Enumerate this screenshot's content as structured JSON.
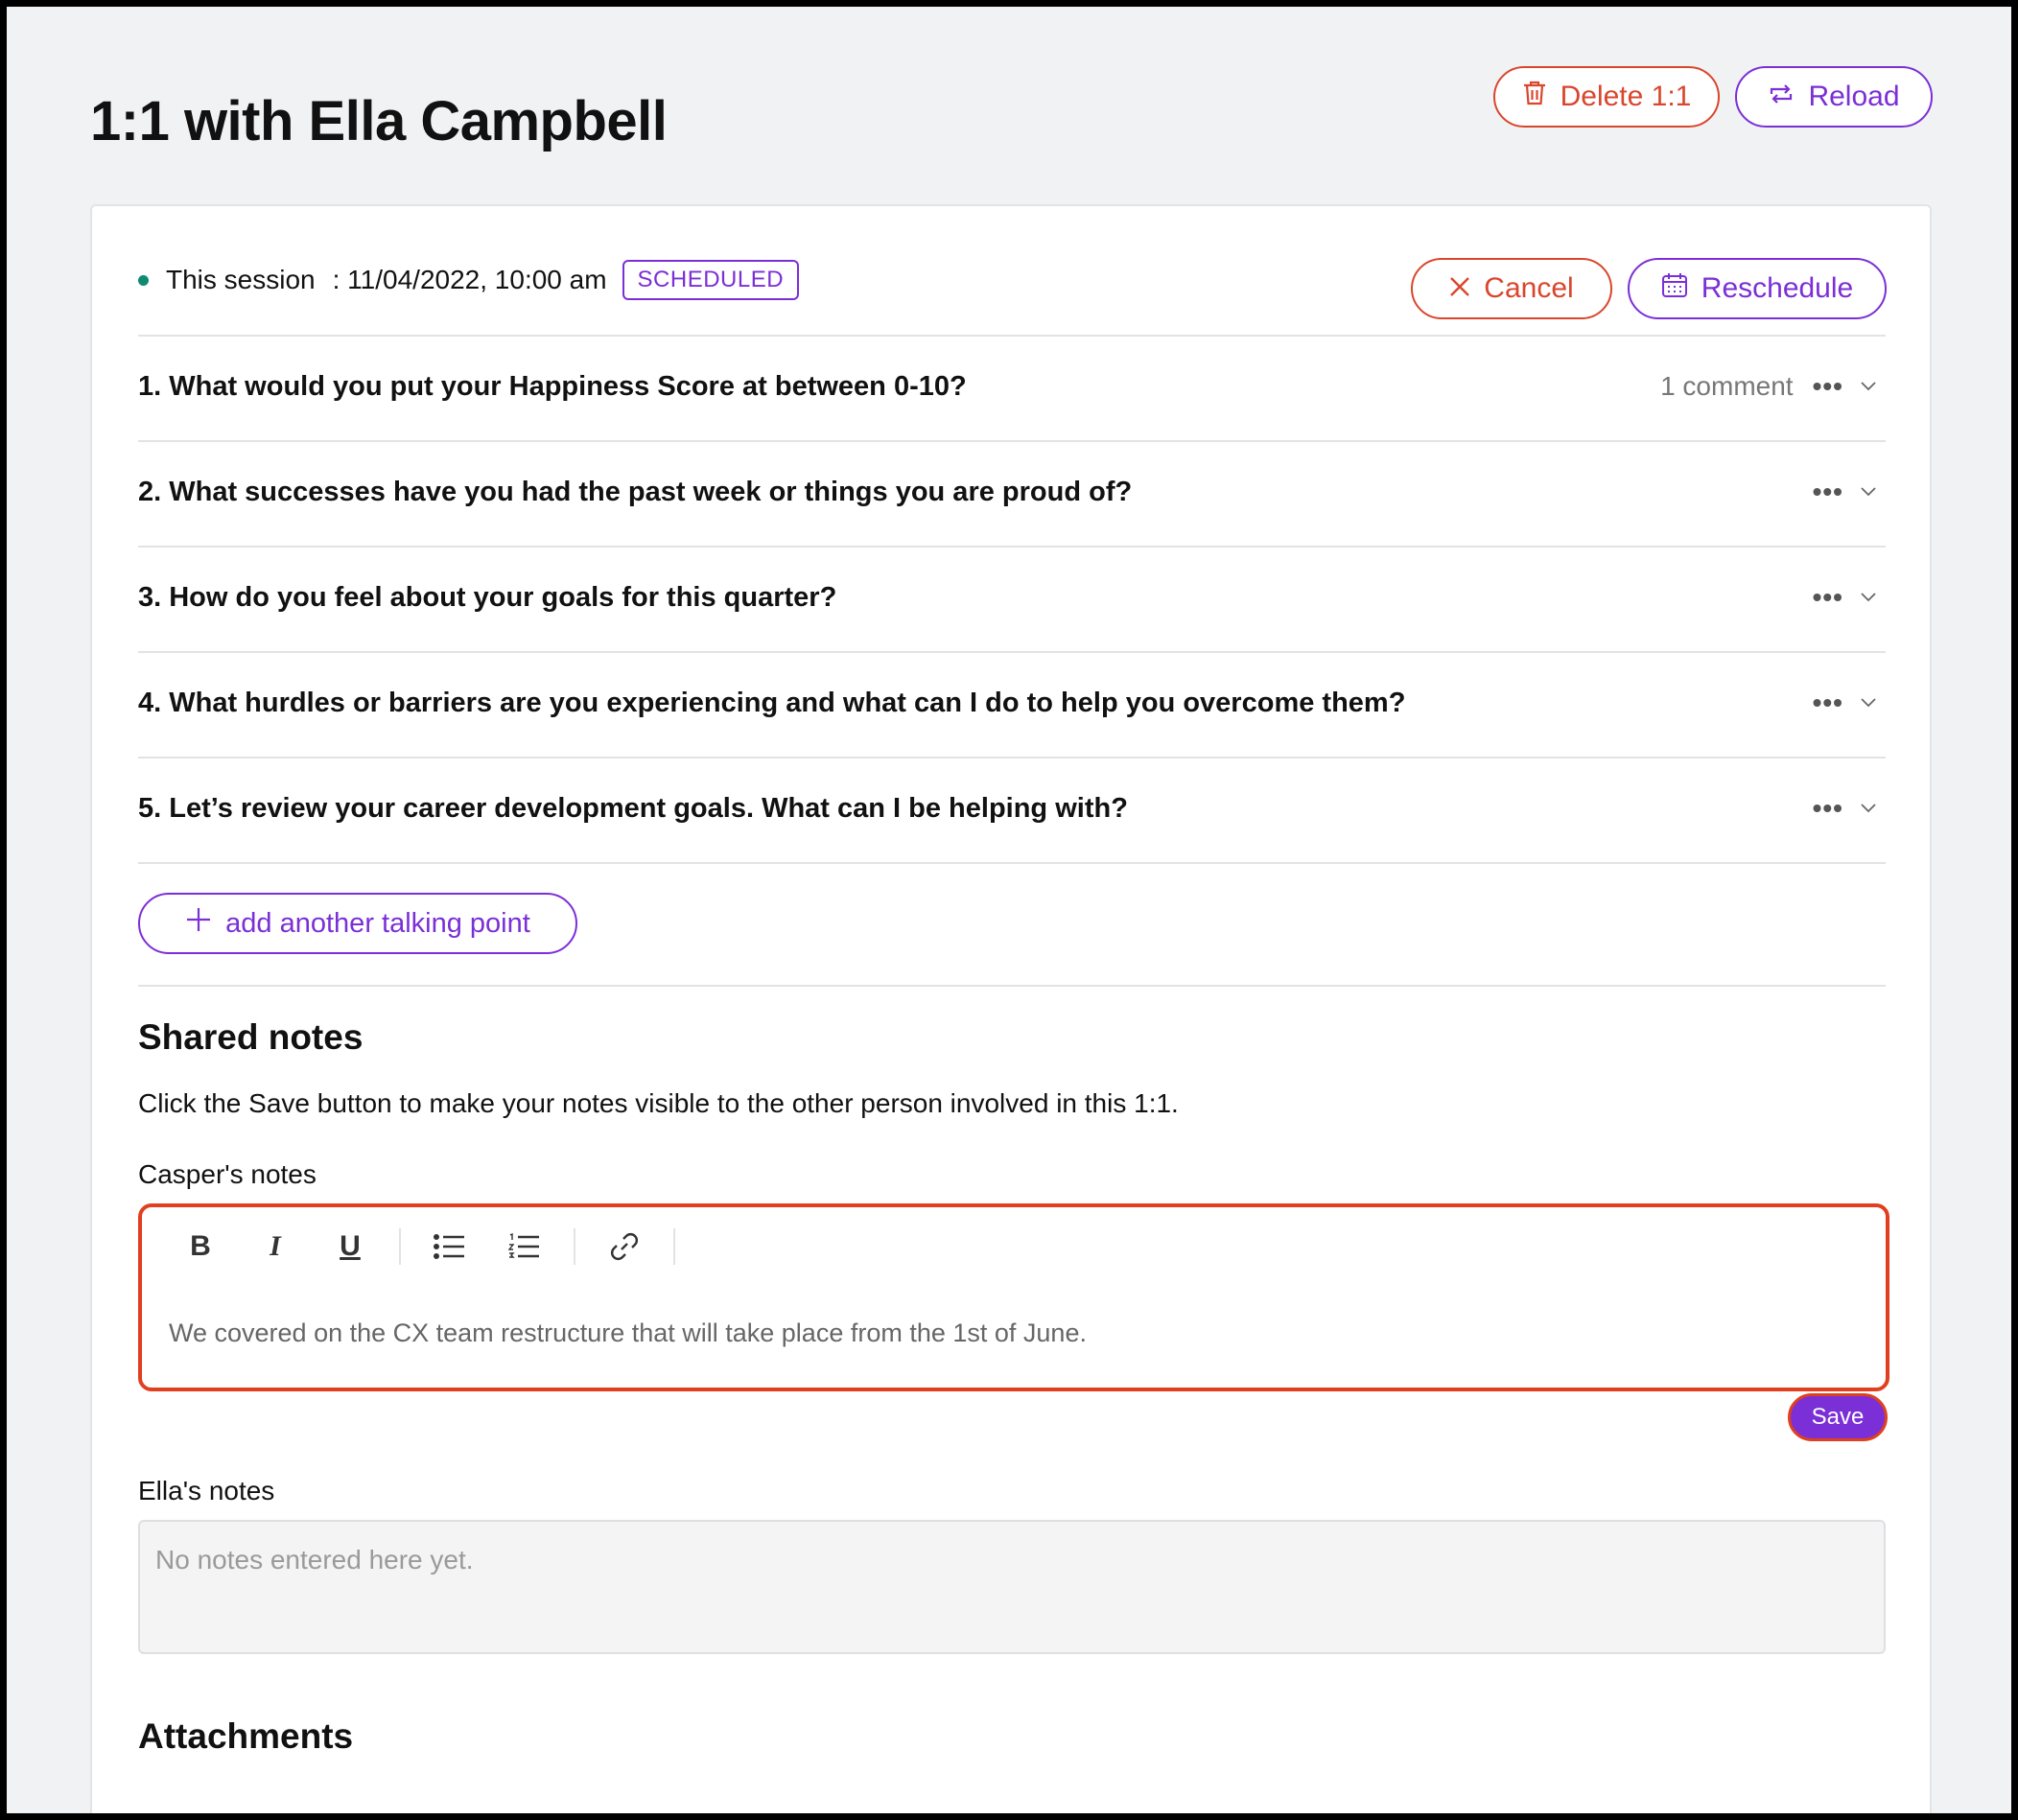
{
  "header": {
    "title": "1:1 with Ella Campbell",
    "delete_label": "Delete 1:1",
    "reload_label": "Reload"
  },
  "session": {
    "label": "This session",
    "datetime": ": 11/04/2022, 10:00 am",
    "status": "SCHEDULED",
    "cancel_label": "Cancel",
    "reschedule_label": "Reschedule"
  },
  "talking_points": [
    {
      "text": "1. What would you put your Happiness Score at between 0-10?",
      "comments": "1 comment"
    },
    {
      "text": "2. What successes have you had the past week or things you are proud of?",
      "comments": ""
    },
    {
      "text": "3. How do you feel about your goals for this quarter?",
      "comments": ""
    },
    {
      "text": "4. What hurdles or barriers are you experiencing and what can I do to help you overcome them?",
      "comments": ""
    },
    {
      "text": "5. Let’s review your career development goals. What can I be helping with?",
      "comments": ""
    }
  ],
  "add_talking_point_label": "add another talking point",
  "shared_notes": {
    "heading": "Shared notes",
    "description": "Click the Save button to make your notes visible to the other person involved in this 1:1.",
    "casper_label": "Casper's notes",
    "casper_text": "We covered on the CX team restructure that will take place from the 1st of June.",
    "save_label": "Save",
    "ella_label": "Ella's notes",
    "ella_placeholder": "No notes entered here yet."
  },
  "attachments": {
    "heading": "Attachments"
  },
  "colors": {
    "accent_purple": "#7b2fd6",
    "danger_red": "#d9462d",
    "status_dot": "#0f8a72"
  },
  "icons": {
    "delete": "trash-icon",
    "reload": "reload-icon",
    "cancel": "close-icon",
    "reschedule": "calendar-icon",
    "more": "more-dots-icon",
    "expand": "chevron-down-icon",
    "add": "plus-icon"
  }
}
